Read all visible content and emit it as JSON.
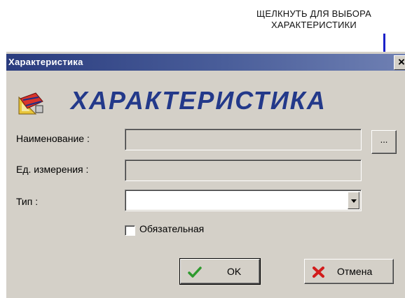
{
  "annotation": {
    "line1": "ЩЕЛКНУТЬ ДЛЯ ВЫБОРА",
    "line2": "ХАРАКТЕРИСТИКИ"
  },
  "dialog": {
    "title": "Характеристика",
    "close_label": "×",
    "header_title": "ХАРАКТЕРИСТИКА",
    "header_icon": "ruler-pencil-icon"
  },
  "form": {
    "name_label": "Наименование :",
    "name_value": "",
    "browse_label": "...",
    "unit_label": "Ед. измерения :",
    "unit_value": "",
    "type_label": "Тип :",
    "type_value": "",
    "required_label": "Обязательная",
    "required_checked": false
  },
  "buttons": {
    "ok_label": "OK",
    "cancel_label": "Отмена"
  },
  "colors": {
    "annotation_line": "#1b22c9",
    "titlebar": "#2a3c7e",
    "header_title": "#23398a",
    "ok_icon": "#2e9a2e",
    "cancel_icon": "#d21c1c"
  }
}
